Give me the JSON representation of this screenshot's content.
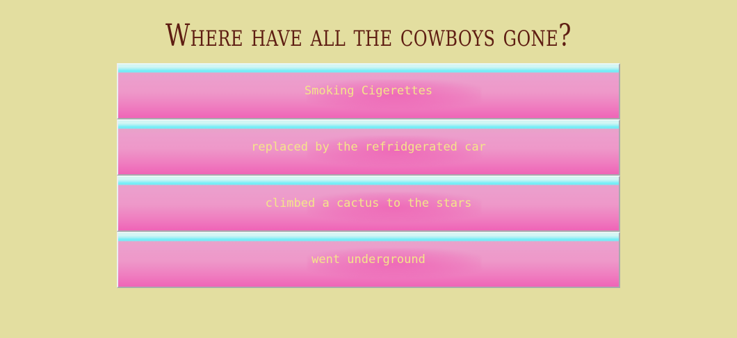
{
  "question": {
    "title": "Where have all the cowboys gone?"
  },
  "options": [
    {
      "label": "Smoking Cigerettes"
    },
    {
      "label": "replaced by the refridgerated car"
    },
    {
      "label": "climbed a cactus to the stars"
    },
    {
      "label": "went underground"
    }
  ],
  "colors": {
    "background": "#e3dea0",
    "title": "#5e1d12",
    "button_top_stripe": "#71eef7",
    "button_pink": "#ef61b6",
    "label_text": "#f4e58a"
  }
}
